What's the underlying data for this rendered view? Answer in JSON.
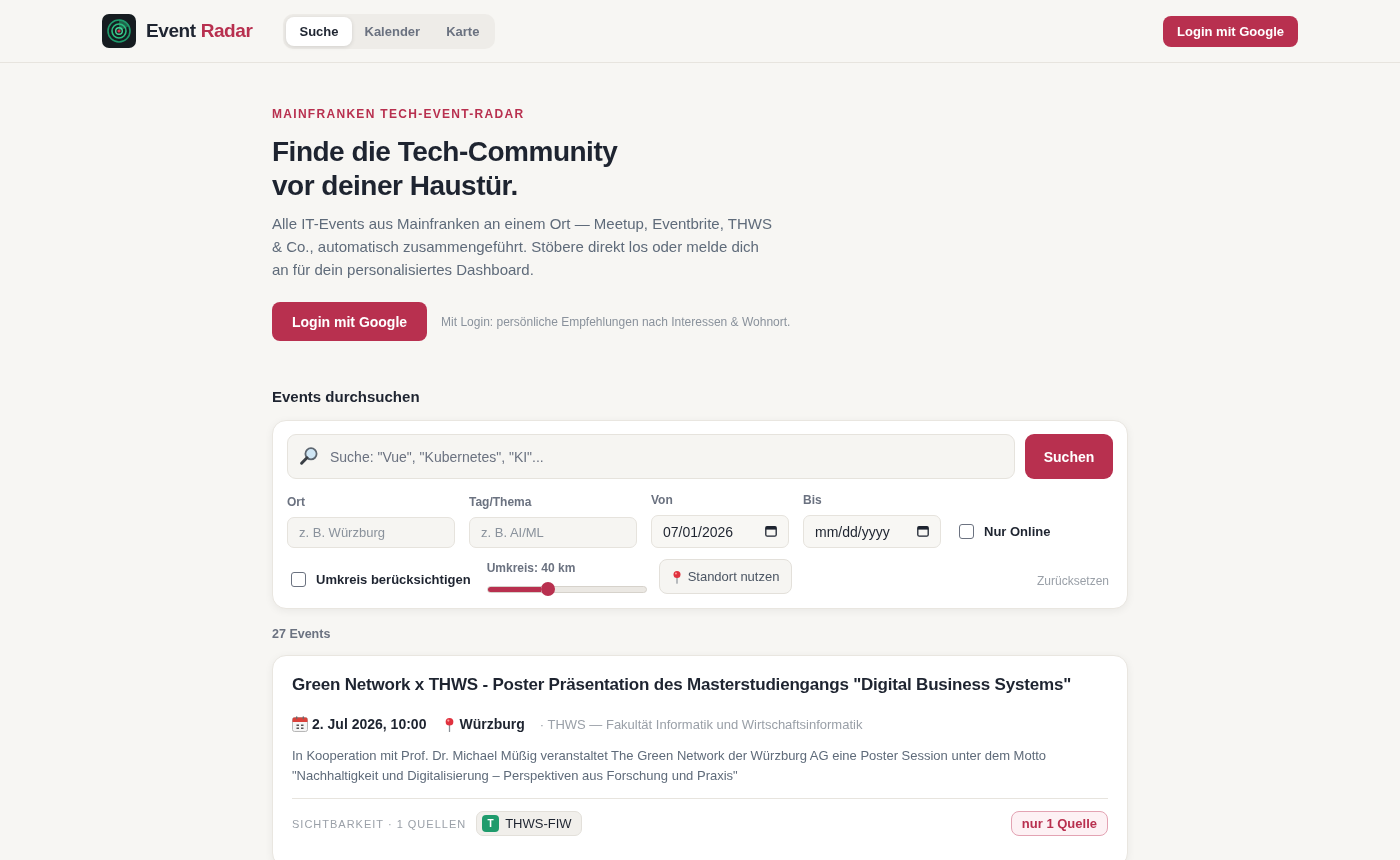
{
  "header": {
    "brand": {
      "name": "Event",
      "accent": "Radar"
    },
    "tabs": [
      {
        "label": "Suche",
        "selected": true
      },
      {
        "label": "Kalender",
        "selected": false
      },
      {
        "label": "Karte",
        "selected": false
      }
    ],
    "login_button": "Login mit Google"
  },
  "hero": {
    "eyebrow": "MAINFRANKEN TECH-EVENT-RADAR",
    "heading": "Finde die Tech-Community\nvor deiner Haustür.",
    "text": "Alle IT-Events aus Mainfranken an einem Ort — Meetup, Eventbrite, THWS & Co., automatisch zusammengeführt. Stöbere direkt los oder melde dich an für dein personalisiertes Dashboard.",
    "login_button": "Login mit Google",
    "note": "Mit Login: persönliche Empfehlungen nach Interessen & Wohnort."
  },
  "search": {
    "heading": "Events durchsuchen",
    "query": {
      "placeholder": "Suche: \"Vue\", \"Kubernetes\", \"KI\"..."
    },
    "submit": "Suchen",
    "filters": [
      {
        "kind": "text",
        "label": "Ort",
        "placeholder": "z. B. Würzburg"
      },
      {
        "kind": "text",
        "label": "Tag/Thema",
        "placeholder": "z. B. AI/ML"
      },
      {
        "kind": "date",
        "label": "Von",
        "value": "07/01/2026"
      },
      {
        "kind": "date",
        "label": "Bis",
        "placeholder": "mm/dd/yyyy"
      },
      {
        "kind": "checkbox",
        "label": "Nur Online",
        "checked": false
      }
    ],
    "radius_toggle": {
      "label": "Umkreis berücksichtigen",
      "checked": false
    },
    "radius": {
      "label": "Umkreis: 40 km",
      "level": 0.38
    },
    "location_button": "Standort nutzen",
    "reset": "Zurücksetzen"
  },
  "results": {
    "count": "27 Events",
    "events": [
      {
        "title": "Green Network x THWS - Poster Präsentation des Masterstudiengangs \"Digital Business Systems\"",
        "date": "2. Jul 2026, 10:00",
        "place": "Würzburg",
        "organizer": "· THWS — Fakultät Informatik und Wirtschaftsinformatik",
        "description": "In Kooperation mit Prof. Dr. Michael Müßig veranstaltet The Green Network der Würzburg AG eine Poster Session unter dem Motto \"Nachhaltigkeit und Digitalisierung – Perspektiven aus Forschung und Praxis\"",
        "visibility": "SICHTBARKEIT · 1 QUELLEN",
        "sources": [
          {
            "initial": "T",
            "name": "THWS-FIW",
            "color": "#1f9b6c"
          }
        ],
        "badge": "nur 1 Quelle"
      }
    ]
  }
}
